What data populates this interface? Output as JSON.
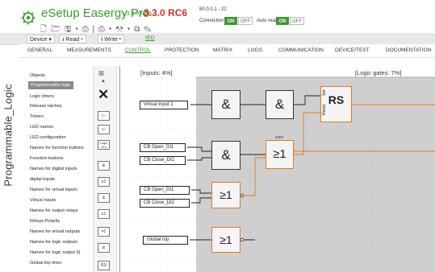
{
  "page_label": "Programmable_Logic",
  "app": {
    "title": "eSetup Easergy Pro",
    "version": "v3.3.0 RC6",
    "rc": "3.3.0 RC6",
    "toolbar_icons": "🗋 🗁 🖫 ▾ ⎙ | ⎙ ▾ ⚒ ▾ ⧉ ✎",
    "ip": "80.0.0.1 - 22"
  },
  "connection": {
    "label": "Connection",
    "on": "ON",
    "off": "OFF"
  },
  "auto_read": {
    "label": "Auto read",
    "on": "ON",
    "off": "OFF"
  },
  "menu": {
    "device": "Device ▾",
    "read": "⭳ Read ▾",
    "write": "⭱ Write ▾",
    "ied": "IED"
  },
  "tabs": [
    "GENERAL",
    "MEASUREMENTS",
    "CONTROL",
    "PROTECTION",
    "MATRIX",
    "LOGS",
    "COMMUNICATION",
    "DEVICE/TEST",
    "DOCUMENTATION"
  ],
  "active_tab": "CONTROL",
  "sidebar": {
    "items": [
      "Objects",
      "Programmable logic",
      "Logic timers",
      "Release latches",
      "Timers",
      "LED names",
      "LED configuration",
      "Names for function buttons",
      "Function buttons",
      "Names for digital inputs",
      "digital inputs",
      "Names for virtual inputs",
      "Virtual inputs",
      "Names for output relays",
      "Relays Polarity",
      "Names for virtual outputs",
      "Names for logic outputs",
      "Names for logic output (l)",
      "Global trip timer"
    ],
    "selected": "Programmable logic"
  },
  "toolbox": {
    "menu_icon": "≡",
    "up_icon": "▲",
    "close_icon": "✕",
    "tools": [
      "▷",
      "-▷",
      "Logic Out",
      "&",
      "≥1",
      "&",
      "≥1",
      "=1",
      "⧖",
      "RS"
    ]
  },
  "canvas": {
    "inputs_header": "[Inputs: 4%]",
    "gates_header": "[Logic gates: 7%]",
    "inputs": [
      "Virtual input 1",
      "CB Open_DI1",
      "CB Close_DI2",
      "CB Open_DI1",
      "CB Close_DI2",
      "Global trip"
    ],
    "gates": {
      "and1": "&",
      "and2": "&",
      "and3": "&",
      "or_top": "≥1",
      "or_top_label": "2000",
      "or_mid": "≥1",
      "or_bottom": "≥1",
      "rs": "RS",
      "rs_set": "Set",
      "rs_reset": "Reset"
    }
  }
}
